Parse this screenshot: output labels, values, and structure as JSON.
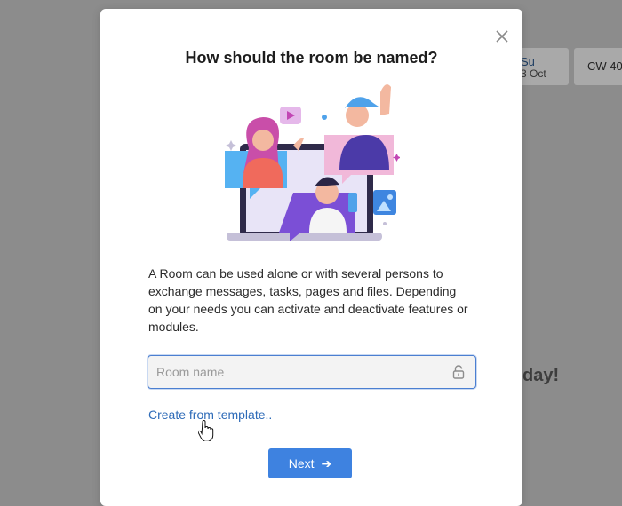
{
  "background": {
    "day_name": "Su",
    "day_date": "3 Oct",
    "week_label": "CW 40",
    "greeting_fragment": "day!"
  },
  "modal": {
    "title": "How should the room be named?",
    "description": "A Room can be used alone or with several persons to exchange messages, tasks, pages and files. Depending on your needs you can activate and deactivate features or modules.",
    "room_name_placeholder": "Room name",
    "room_name_value": "",
    "template_link": "Create from template..",
    "next_label": "Next",
    "next_icon": "arrow-right-icon",
    "close_icon": "close-icon",
    "lock_icon": "lock-icon",
    "accent_color": "#3e82e0"
  }
}
